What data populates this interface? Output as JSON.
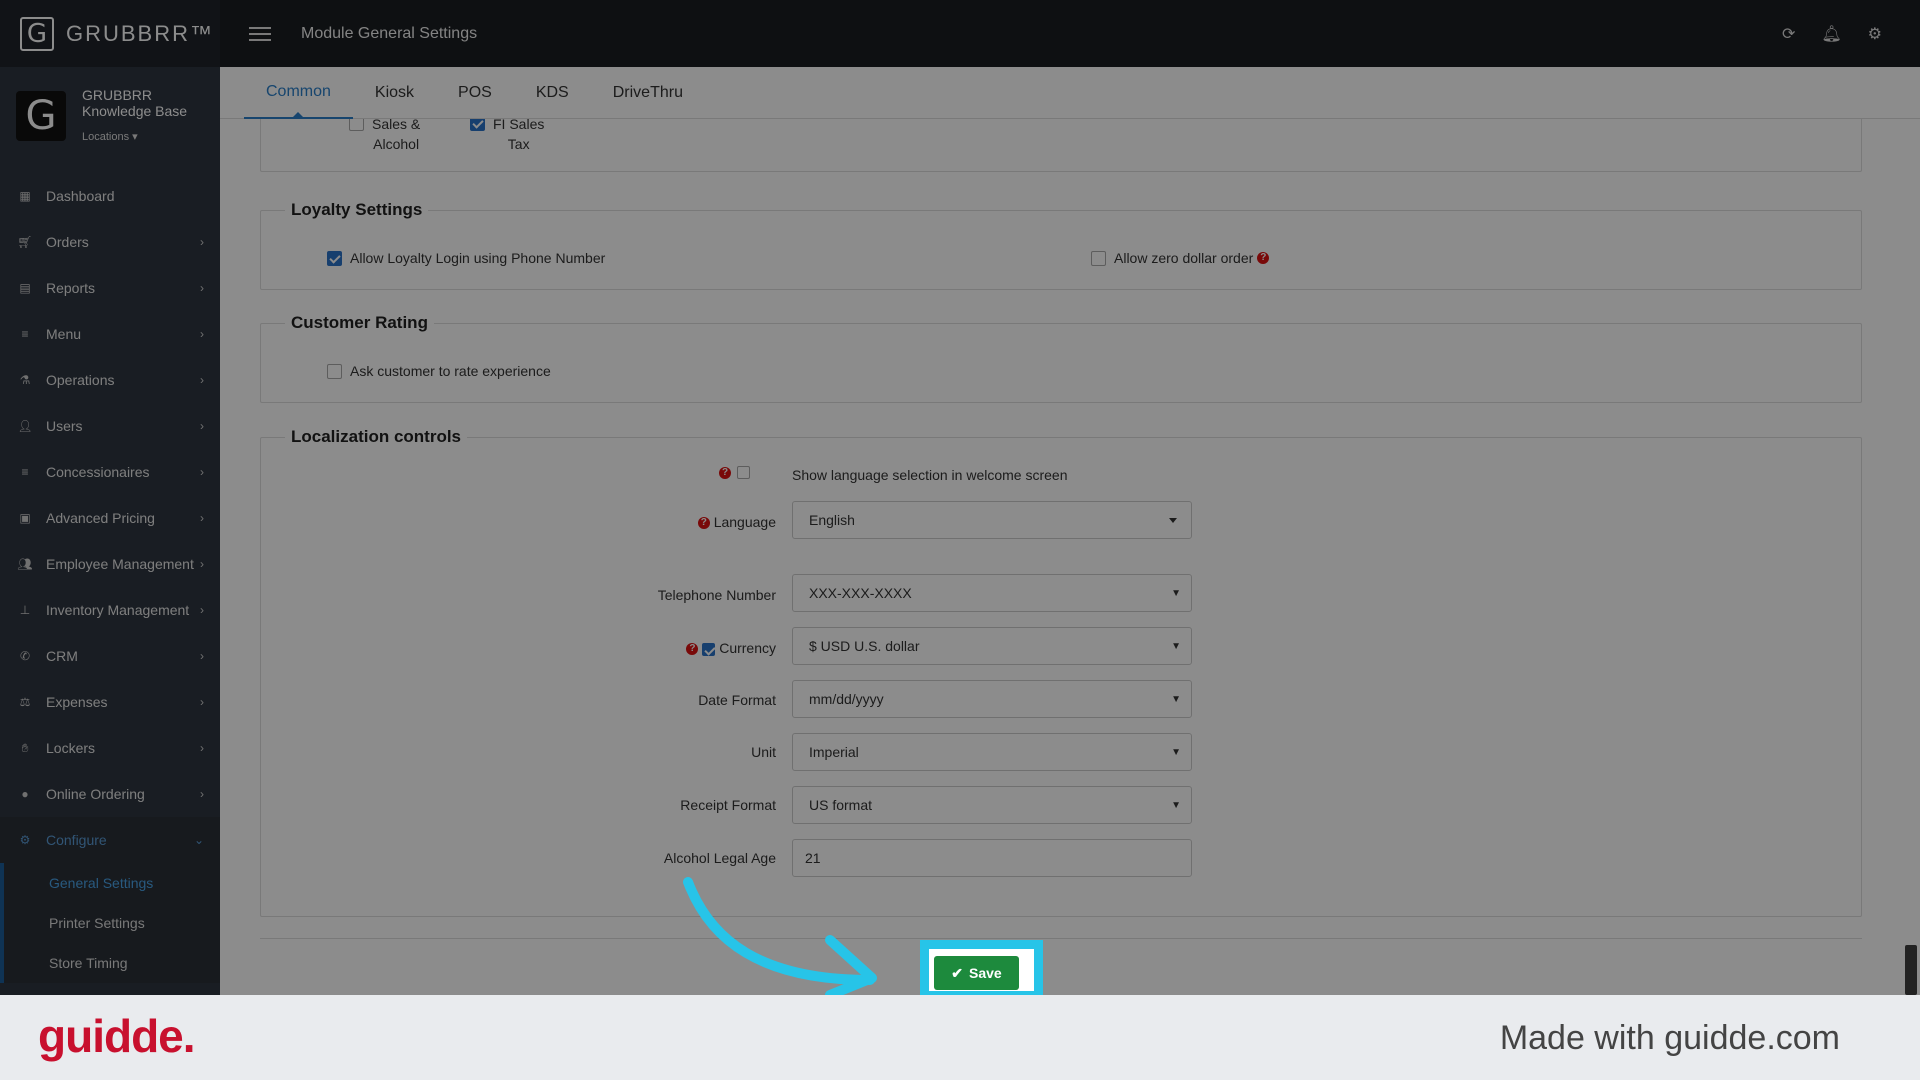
{
  "brand": {
    "letter": "G",
    "name": "GRUBBRR™"
  },
  "knowledge_base": {
    "logo_letter": "G",
    "line1": "GRUBBRR",
    "line2": "Knowledge Base",
    "locations": "Locations ▾"
  },
  "topbar": {
    "title": "Module General Settings"
  },
  "tabs": [
    "Common",
    "Kiosk",
    "POS",
    "KDS",
    "DriveThru"
  ],
  "sidebar": {
    "items": [
      {
        "label": "Dashboard",
        "icon": "dashboard-icon"
      },
      {
        "label": "Orders",
        "icon": "cart-icon"
      },
      {
        "label": "Reports",
        "icon": "report-icon"
      },
      {
        "label": "Menu",
        "icon": "list-icon"
      },
      {
        "label": "Operations",
        "icon": "flask-icon"
      },
      {
        "label": "Users",
        "icon": "user-add-icon"
      },
      {
        "label": "Concessionaires",
        "icon": "list-icon"
      },
      {
        "label": "Advanced Pricing",
        "icon": "money-icon"
      },
      {
        "label": "Employee Management",
        "icon": "users-icon"
      },
      {
        "label": "Inventory Management",
        "icon": "sitemap-icon"
      },
      {
        "label": "CRM",
        "icon": "phone-icon"
      },
      {
        "label": "Expenses",
        "icon": "balance-icon"
      },
      {
        "label": "Lockers",
        "icon": "hand-icon"
      },
      {
        "label": "Online Ordering",
        "icon": "globe-icon"
      },
      {
        "label": "Configure",
        "icon": "gear-icon"
      }
    ],
    "sub_items": [
      "General Settings",
      "Printer Settings",
      "Store Timing"
    ]
  },
  "tax": {
    "item1_line1": "Sales &",
    "item1_line2": "Alcohol",
    "item2_line1": "FI Sales",
    "item2_line2": "Tax"
  },
  "loyalty": {
    "title": "Loyalty Settings",
    "phone_login": "Allow Loyalty Login using Phone Number",
    "zero_dollar": "Allow zero dollar order"
  },
  "rating": {
    "title": "Customer Rating",
    "ask": "Ask customer to rate experience"
  },
  "localization": {
    "title": "Localization controls",
    "show_language": "Show language selection in welcome screen",
    "language_label": "Language",
    "language_value": "English",
    "telephone_label": "Telephone Number",
    "telephone_value": "XXX-XXX-XXXX",
    "currency_label": "Currency",
    "currency_value": "$ USD U.S. dollar",
    "date_label": "Date Format",
    "date_value": "mm/dd/yyyy",
    "unit_label": "Unit",
    "unit_value": "Imperial",
    "receipt_label": "Receipt Format",
    "receipt_value": "US format",
    "alcohol_label": "Alcohol Legal Age",
    "alcohol_value": "21"
  },
  "save_label": "Save",
  "footer": {
    "logo": "guidde.",
    "made_with": "Made with guidde.com"
  },
  "colors": {
    "accent": "#2a7fc9",
    "save": "#1d8a3d",
    "highlight": "#27c4e8",
    "guidde": "#c8102e"
  }
}
